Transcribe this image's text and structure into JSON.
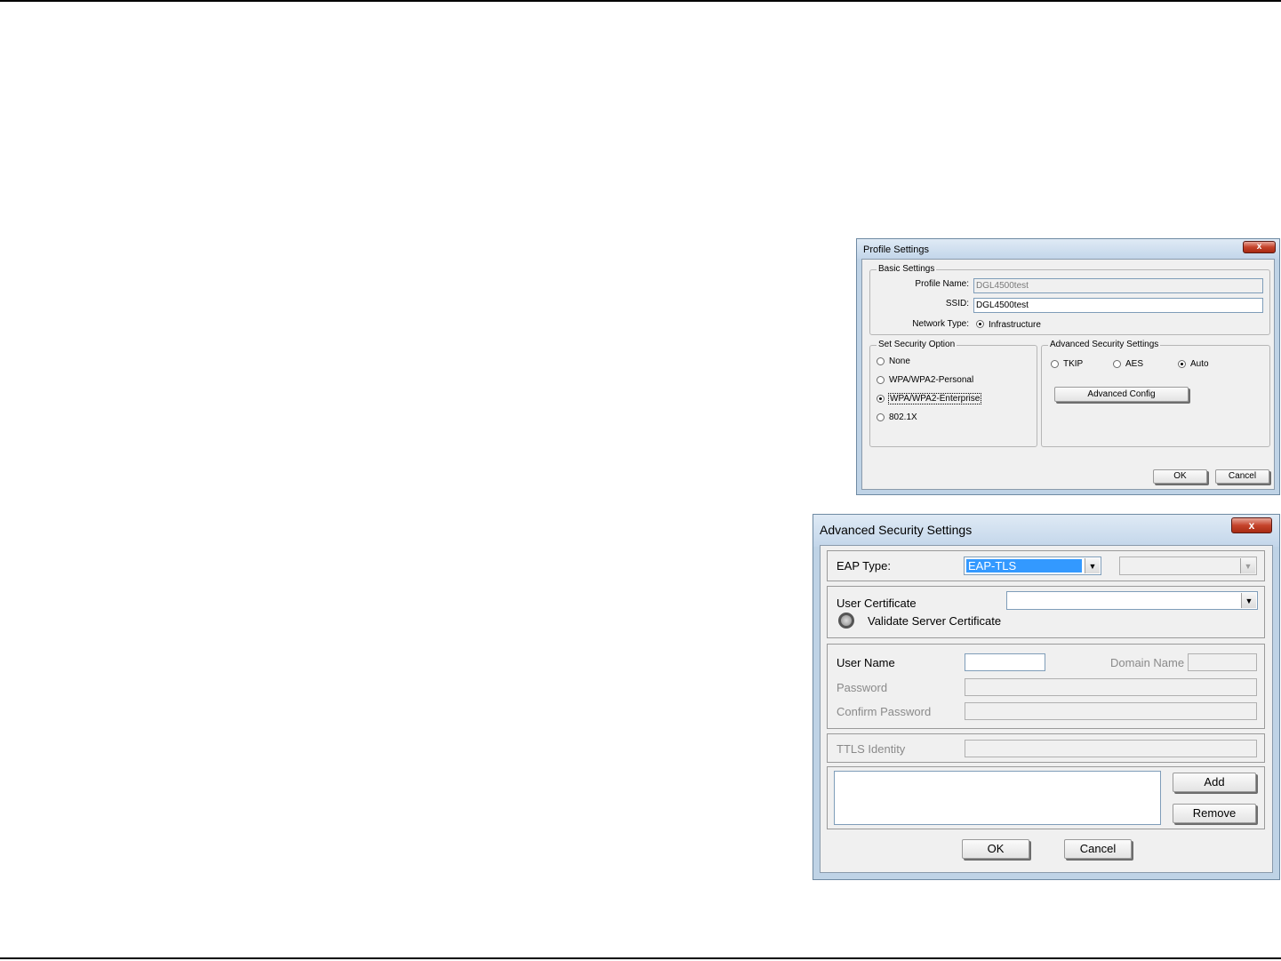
{
  "profile_dialog": {
    "title": "Profile Settings",
    "close_glyph": "x",
    "basic": {
      "legend": "Basic Settings",
      "profile_name_label": "Profile Name:",
      "profile_name_value": "DGL4500test",
      "ssid_label": "SSID:",
      "ssid_value": "DGL4500test",
      "network_type_label": "Network Type:",
      "network_type_option": "Infrastructure"
    },
    "security_option": {
      "legend": "Set Security Option",
      "options": [
        "None",
        "WPA/WPA2-Personal",
        "WPA/WPA2-Enterprise",
        "802.1X"
      ],
      "selected": "WPA/WPA2-Enterprise"
    },
    "advanced": {
      "legend": "Advanced Security Settings",
      "options": [
        "TKIP",
        "AES",
        "Auto"
      ],
      "selected": "Auto",
      "config_button": "Advanced Config"
    },
    "ok_button": "OK",
    "cancel_button": "Cancel"
  },
  "advanced_dialog": {
    "title": "Advanced Security Settings",
    "close_glyph": "x",
    "eap_type_label": "EAP Type:",
    "eap_type_value": "EAP-TLS",
    "eap_sub_value": "",
    "user_certificate_label": "User Certificate",
    "user_certificate_value": "",
    "validate_server_label": "Validate Server Certificate",
    "user_name_label": "User Name",
    "user_name_value": "",
    "domain_name_label": "Domain Name",
    "password_label": "Password",
    "confirm_password_label": "Confirm Password",
    "ttls_identity_label": "TTLS Identity",
    "add_button": "Add",
    "remove_button": "Remove",
    "ok_button": "OK",
    "cancel_button": "Cancel",
    "colors": {
      "selection": "#3399ff"
    }
  }
}
